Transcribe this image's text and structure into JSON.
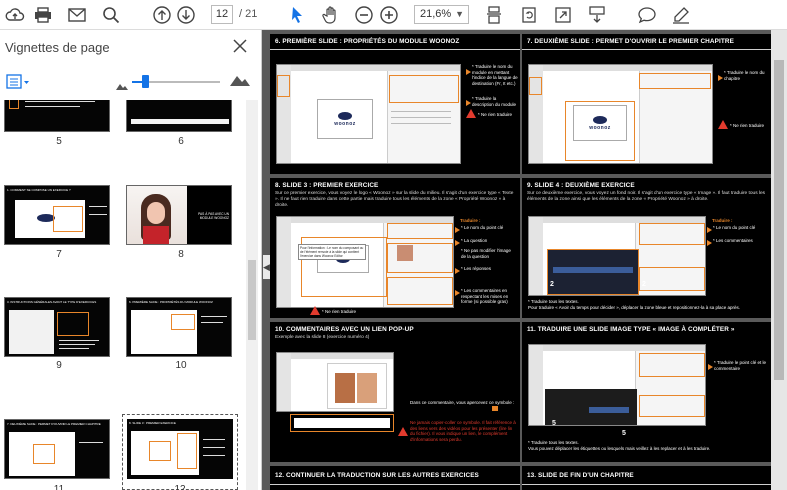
{
  "toolbar": {
    "icons": [
      "cloud-upload-icon",
      "print-icon",
      "email-icon",
      "search-icon",
      "page-up-icon",
      "page-down-icon",
      "select-pointer-icon",
      "hand-tool-icon",
      "zoom-out-icon",
      "zoom-in-icon",
      "fit-page-icon",
      "rotate-icon",
      "full-screen-icon",
      "scroll-mode-icon",
      "comment-icon",
      "highlight-pen-icon"
    ],
    "current_page": "12",
    "total_pages": "/ 21",
    "zoom": "21,6%",
    "accent": "#1473e6"
  },
  "sidebar": {
    "title": "Vignettes de page",
    "thumbnails": [
      {
        "num": "5"
      },
      {
        "num": "6"
      },
      {
        "num": "7",
        "caption": "1. COMMENT SE COMPOSE UN EXERCICE ?"
      },
      {
        "num": "8",
        "caption": "PAS À PAS AVEC UN MODULE WOONOZ"
      },
      {
        "num": "9",
        "caption": "3. INSTRUCTIONS GÉNÉRALES AVANT LE TYPE D'EXERCICES"
      },
      {
        "num": "10",
        "caption": "6. PREMIÈRE SLIDE : PROPRIÉTÉS DU MODULE WOONOZ"
      },
      {
        "num": "11",
        "caption": "7. DEUXIÈME SLIDE : PERMET D'OUVRIR LE PREMIER CHAPITRE"
      },
      {
        "num": "12",
        "caption": "8. SLIDE 3 : PREMIER EXERCICE"
      }
    ]
  },
  "slides": {
    "s6": {
      "title": "6. PREMIÈRE SLIDE : PROPRIÉTÉS DU MODULE WOONOZ",
      "note1": "* Traduire le nom du module en mettant l'indice de la langue de destination (Fr, It etc.)",
      "note2": "* Traduire la description du module",
      "warn": "* Ne rien traduire",
      "logo": "woonoz"
    },
    "s7": {
      "title": "7. DEUXIÈME SLIDE : PERMET D'OUVRIR LE PREMIER CHAPITRE",
      "note1": "* Traduire le nom du chapitre",
      "warn": "* Ne rien traduire",
      "logo": "woonoz"
    },
    "s8": {
      "title": "8. SLIDE 3 : PREMIER EXERCICE",
      "sub": "Sur ce premier exercice, vous voyez le logo « Woonoz » sur la slide du milieu. Il s'agit d'un exercice type « Texte ». Il ne faut rien traduire dans cette partie mais traduire tous les éléments de la zone « Propriété Woonoz » à droite.",
      "translate": "Traduire :",
      "n1": "* Le nom du point clé",
      "n2": "* La question",
      "n3": "* Ne pas modifier l'image de la question",
      "n4": "* Les réponses",
      "n5": "* Les commentaires en respectant les mises en forme (si possible gras)",
      "side": "Pour l'information : Le nom du composant ou de l'élément renvoie à la slide qui contient l'exercice dans Woonoz Editor",
      "warn": "* Ne rien traduire"
    },
    "s9": {
      "title": "9. SLIDE 4 : DEUXIÈME EXERCICE",
      "sub": "Sur ce deuxième exercice, vous voyez un fond noir. Il s'agit d'un exercice type « Image ». Il faut traduire tous les éléments de la zone ainsi que les éléments de la zone « Propriété Woonoz » à droite.",
      "translate": "Traduire :",
      "n1": "* Le nom du point clé",
      "n2": "* Les commentaires",
      "n3": "* Traduire tous les textes.",
      "n4": "Pour traduire « Avoir du temps pour décider », déplacer la zone bleue et repositionnez-la à sa place après."
    },
    "s10": {
      "title": "10. COMMENTAIRES AVEC UN LIEN POP-UP",
      "sub": "Exemple avec la slide 8 (exercice numéro 4)",
      "n1": "Dans ce commentaire, vous apercevez ce symbole :",
      "warn": "Ne jamais copier-coller ce symbole. Il fait référence à des liens vers des vidéos pour les présenter (lire lin du fichier). Il vous indique un lien, le complément d'informations sera perdu."
    },
    "s11": {
      "title": "11. TRADUIRE UNE SLIDE IMAGE TYPE « IMAGE À COMPLÉTER »",
      "n1": "* Traduire le point clé et le commentaire",
      "n2": "* Traduire tous les textes.",
      "n3": "Vous pouvez déplacer les étiquettes ou lesquels mais veillez à les replacer et à les traduire.",
      "badge": "5"
    },
    "s12": {
      "title": "12. CONTINUER LA TRADUCTION SUR LES AUTRES EXERCICES"
    },
    "s13": {
      "title": "13. SLIDE DE FIN D'UN CHAPITRE"
    }
  }
}
